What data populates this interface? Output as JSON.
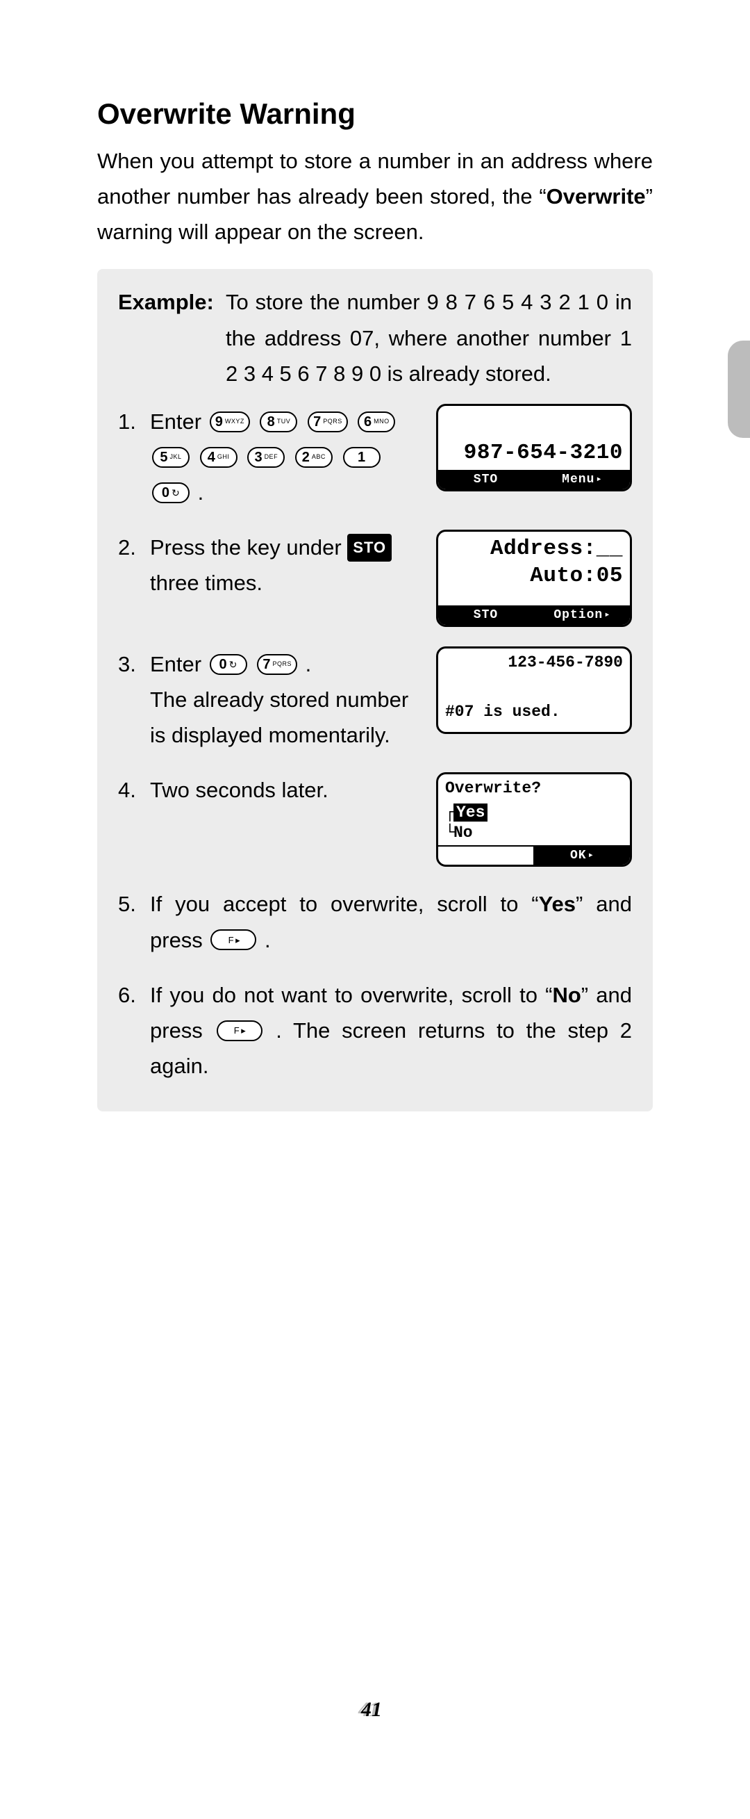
{
  "title": "Overwrite Warning",
  "intro_pre": "When you attempt to store a number in an address where another number has already been stored, the “",
  "intro_bold": "Overwrite",
  "intro_post": "” warning will appear on the screen.",
  "example": {
    "label": "Example:",
    "text": "To store the number 9 8 7 6 5 4 3 2 1 0 in the address 07, where another number 1 2 3 4 5 6 7 8 9 0 is already stored."
  },
  "keys": {
    "k9": {
      "d": "9",
      "sub": "WXYZ"
    },
    "k8": {
      "d": "8",
      "sub": "TUV"
    },
    "k7": {
      "d": "7",
      "sub": "PQRS"
    },
    "k6": {
      "d": "6",
      "sub": "MNO"
    },
    "k5": {
      "d": "5",
      "sub": "JKL"
    },
    "k4": {
      "d": "4",
      "sub": "GHI"
    },
    "k3": {
      "d": "3",
      "sub": "DEF"
    },
    "k2": {
      "d": "2",
      "sub": "ABC"
    },
    "k1": {
      "d": "1",
      "sub": ""
    },
    "k0": {
      "d": "0",
      "sub": "↻"
    },
    "kf": {
      "d": "F",
      "sub": "▸"
    }
  },
  "steps": {
    "s1": {
      "num": "1.",
      "lead": "Enter ",
      "trail": "."
    },
    "s2": {
      "num": "2.",
      "lead": "Press the key under ",
      "sto": "STO",
      "trail": " three times."
    },
    "s3": {
      "num": "3.",
      "lead": "Enter ",
      "trail": ".",
      "line2": "The already stored number is displayed momentarily."
    },
    "s4": {
      "num": "4.",
      "text": "Two seconds later."
    },
    "s5": {
      "num": "5.",
      "pre": "If you accept to overwrite, scroll to “",
      "bold": "Yes",
      "mid": "” and press ",
      "post": "."
    },
    "s6": {
      "num": "6.",
      "pre": "If you do not want to overwrite, scroll to “",
      "bold": "No",
      "mid": "” and press ",
      "post": ". The screen returns to the step 2 again."
    }
  },
  "screens": {
    "sc1": {
      "line": "987-654-3210",
      "left": "STO",
      "right": "Menu",
      "arrow": "▸"
    },
    "sc2": {
      "l1": "Address:__",
      "l2": "Auto:05",
      "left": "STO",
      "right": "Option",
      "arrow": "▸"
    },
    "sc3": {
      "l1": "123-456-7890",
      "l2": "#07 is used."
    },
    "sc4": {
      "l1": "Overwrite?",
      "yes": "Yes",
      "no": "No",
      "right": "OK",
      "arrow": "▸"
    }
  },
  "page_number": "41"
}
